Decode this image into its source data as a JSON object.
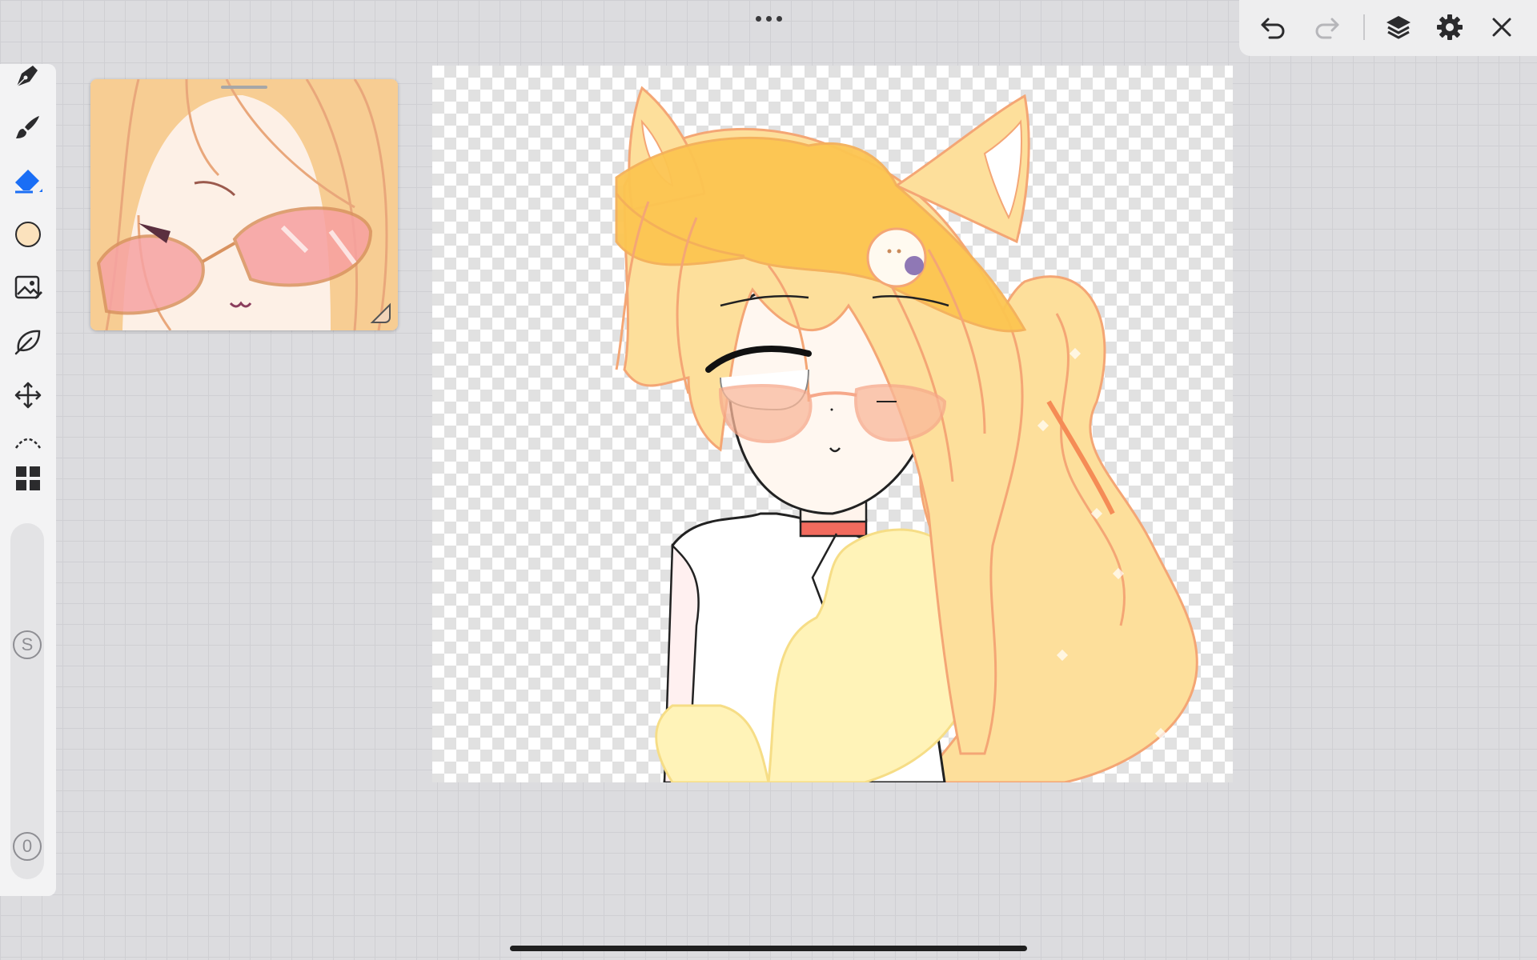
{
  "top_center": {
    "icon": "more-horizontal-icon"
  },
  "topbar": {
    "buttons": [
      {
        "name": "undo",
        "icon": "undo-icon",
        "enabled": true
      },
      {
        "name": "redo",
        "icon": "redo-icon",
        "enabled": false
      },
      {
        "name": "layers",
        "icon": "layers-icon",
        "enabled": true
      },
      {
        "name": "settings",
        "icon": "gear-icon",
        "enabled": true
      },
      {
        "name": "close",
        "icon": "close-icon",
        "enabled": true
      }
    ]
  },
  "toolbar": {
    "tools": [
      {
        "name": "pen",
        "icon": "pen-nib-icon"
      },
      {
        "name": "brush",
        "icon": "brush-icon"
      },
      {
        "name": "eraser",
        "icon": "eraser-icon",
        "active": true
      },
      {
        "name": "color",
        "icon": "color-swatch-icon",
        "color": "#fbe2bd"
      },
      {
        "name": "image",
        "icon": "image-icon"
      },
      {
        "name": "lasso",
        "icon": "lasso-leaf-icon"
      },
      {
        "name": "transform",
        "icon": "move-arrows-icon"
      },
      {
        "name": "curve",
        "icon": "curve-icon"
      },
      {
        "name": "panels",
        "icon": "grid-panels-icon"
      }
    ],
    "size_slider": {
      "label": "S"
    },
    "opacity_slider": {
      "label": "0"
    }
  },
  "reference_panel": {
    "icon": "reference-image"
  },
  "colors": {
    "accent": "#1a6ef5",
    "hair": "#fddf9b",
    "hair_line": "#f4a675",
    "skin": "#fff4ec",
    "glasses": "#f6a88a",
    "collar": "#f26b5e"
  }
}
